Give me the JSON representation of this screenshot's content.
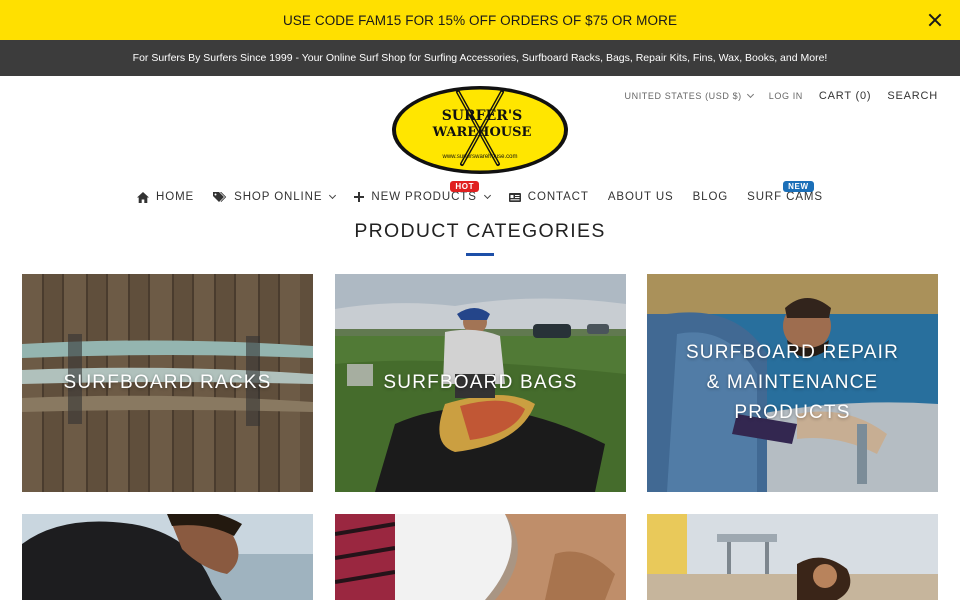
{
  "promo": {
    "text": "USE CODE FAM15 FOR 15% OFF ORDERS OF $75 OR MORE",
    "close_icon": "close-icon"
  },
  "tagline": "For Surfers By Surfers Since 1999 - Your Online Surf Shop for Surfing Accessories, Surfboard Racks, Bags, Repair Kits, Fins, Wax, Books, and More!",
  "utility": {
    "currency": "UNITED STATES (USD $)",
    "login": "LOG IN",
    "cart": "CART (0)",
    "search": "SEARCH"
  },
  "logo": {
    "line1": "SURFER'S",
    "line2": "WAREHOUSE",
    "url": "www.surferswarehouse.com"
  },
  "nav": {
    "home": "HOME",
    "shop": "SHOP ONLINE",
    "new_products": "NEW PRODUCTS",
    "hot_badge": "HOT",
    "contact": "CONTACT",
    "about": "ABOUT US",
    "blog": "BLOG",
    "surf_cams": "SURF CAMS",
    "new_badge": "NEW"
  },
  "section": {
    "title": "PRODUCT CATEGORIES"
  },
  "categories": [
    {
      "label": "SURFBOARD RACKS"
    },
    {
      "label": "SURFBOARD BAGS"
    },
    {
      "label": "SURFBOARD REPAIR & MAINTENANCE PRODUCTS"
    },
    {
      "label": ""
    },
    {
      "label": ""
    },
    {
      "label": ""
    }
  ],
  "colors": {
    "promo_bg": "#ffe000",
    "tagline_bg": "#3c3c3c",
    "accent_underline": "#1d4fa8",
    "hot_badge": "#e02020",
    "new_badge": "#1b6fb8"
  }
}
